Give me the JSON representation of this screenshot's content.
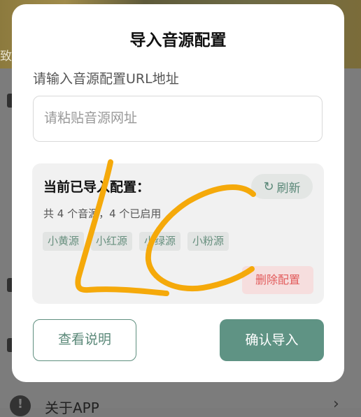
{
  "background": {
    "top_text": "致",
    "bottom_item_label": "关于APP",
    "bottom_item_icon": "info-icon",
    "chevron_icon": "chevron-right-icon"
  },
  "dialog": {
    "title": "导入音源配置",
    "url_label": "请输入音源配置URL地址",
    "url_input": {
      "value": "",
      "placeholder": "请粘贴音源网址"
    },
    "panel": {
      "title": "当前已导入配置：",
      "refresh_label": "刷新",
      "refresh_icon": "refresh-icon",
      "summary": "共 4 个音源，4 个已启用",
      "sources": [
        "小黄源",
        "小红源",
        "小绿源",
        "小粉源"
      ],
      "delete_label": "删除配置"
    },
    "help_button": "查看说明",
    "confirm_button": "确认导入"
  },
  "colors": {
    "accent": "#5f9384",
    "danger": "#e25b5b",
    "scribble": "#f5a90a"
  }
}
